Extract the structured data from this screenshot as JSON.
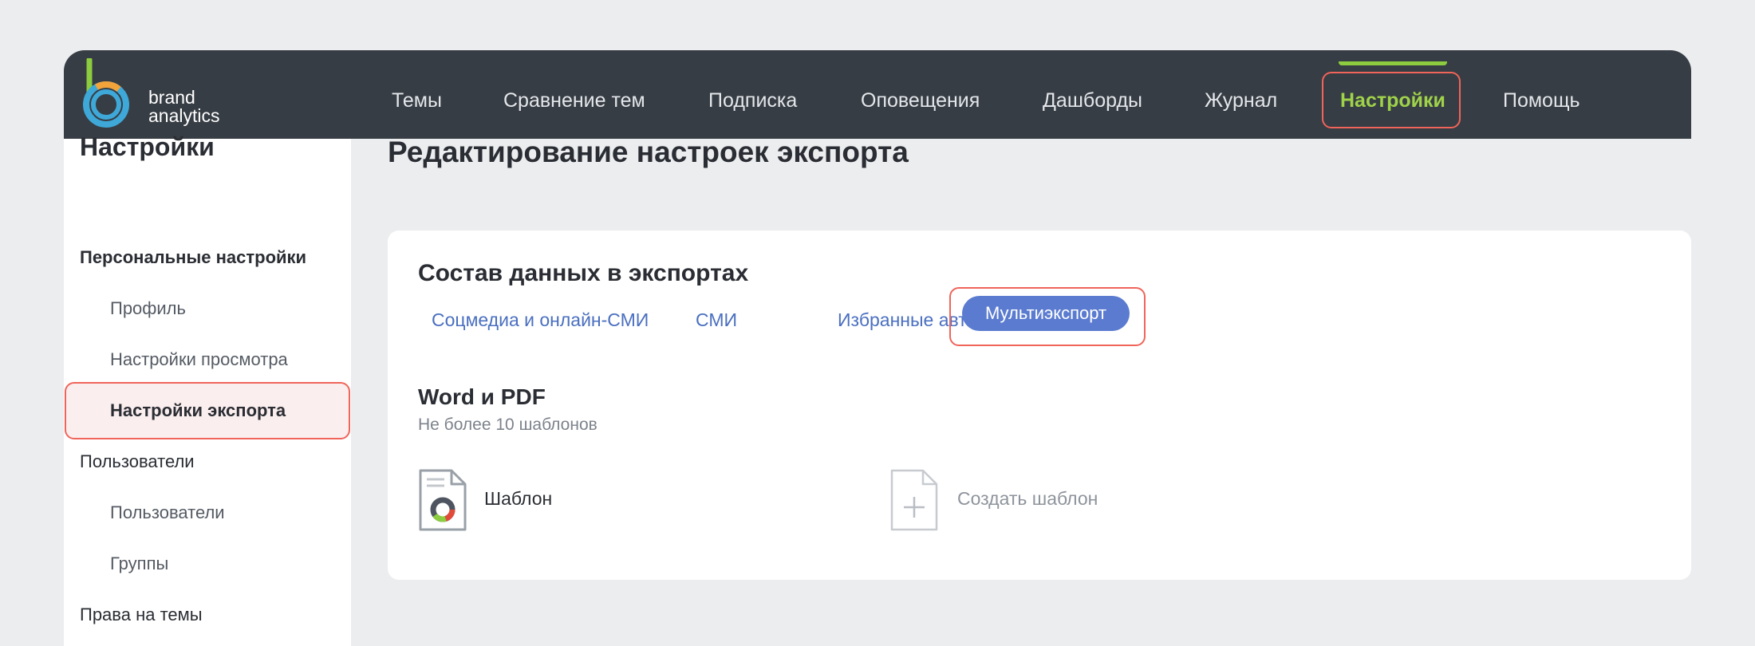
{
  "brand": {
    "line1": "brand",
    "line2": "analytics"
  },
  "nav": {
    "items": [
      {
        "label": "Темы"
      },
      {
        "label": "Сравнение тем"
      },
      {
        "label": "Подписка"
      },
      {
        "label": "Оповещения"
      },
      {
        "label": "Дашборды"
      },
      {
        "label": "Журнал"
      },
      {
        "label": "Настройки"
      },
      {
        "label": "Помощь"
      }
    ],
    "active": "Настройки"
  },
  "sidebar": {
    "title": "Настройки",
    "items": [
      {
        "label": "Персональные настройки"
      },
      {
        "label": "Профиль"
      },
      {
        "label": "Настройки просмотра"
      },
      {
        "label": "Настройки экспорта"
      },
      {
        "label": "Пользователи"
      },
      {
        "label": "Пользователи"
      },
      {
        "label": "Группы"
      },
      {
        "label": "Права на темы"
      }
    ],
    "active": "Настройки экспорта"
  },
  "main": {
    "title": "Редактирование настроек экспорта",
    "card": {
      "title": "Состав данных в экспортах",
      "tabs": [
        {
          "label": "Соцмедиа и онлайн-СМИ"
        },
        {
          "label": "СМИ"
        },
        {
          "label": "Избранные авторы"
        },
        {
          "label": "Мультиэкспорт"
        }
      ],
      "active_tab": "Мультиэкспорт",
      "section": {
        "title": "Word и PDF",
        "subtitle": "Не более 10 шаблонов",
        "template_label": "Шаблон",
        "create_label": "Создать шаблон"
      }
    }
  },
  "colors": {
    "topbar": "#373d44",
    "accent_green": "#8ccc3e",
    "accent_blue": "#5a7bd0",
    "highlight_red": "#f0645a"
  },
  "icons": {
    "logo": "brand-analytics-logo",
    "template": "document-chart-icon",
    "create": "document-plus-icon"
  }
}
